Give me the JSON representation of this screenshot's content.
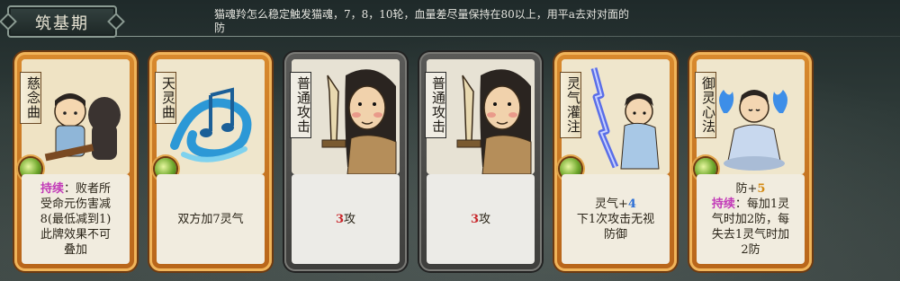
{
  "header": {
    "stage": "筑基期",
    "tip": "猫魂羚怎么稳定触发猫魂，7，8，10轮，血量差尽量保持在80以上，用平a去对对面的防"
  },
  "cards": [
    {
      "name": "慈念曲",
      "style": "gold",
      "desc_lines": [
        [
          {
            "t": "持续",
            "c": "kw-persist"
          },
          {
            "t": "：败者所"
          }
        ],
        [
          {
            "t": "受命元伤害减"
          }
        ],
        [
          {
            "t": "8(最低减到1)"
          }
        ],
        [
          {
            "t": "此牌效果不可"
          }
        ],
        [
          {
            "t": "叠加"
          }
        ]
      ]
    },
    {
      "name": "天灵曲",
      "style": "gold",
      "desc_lines": [
        [
          {
            "t": "双方加7灵气"
          }
        ]
      ]
    },
    {
      "name": "普通攻击",
      "style": "gray",
      "desc_lines": [
        [
          {
            "t": "3",
            "c": "num-red"
          },
          {
            "t": "攻"
          }
        ]
      ]
    },
    {
      "name": "普通攻击",
      "style": "gray",
      "desc_lines": [
        [
          {
            "t": "3",
            "c": "num-red"
          },
          {
            "t": "攻"
          }
        ]
      ]
    },
    {
      "name": "灵气灌注",
      "style": "gold",
      "desc_lines": [
        [
          {
            "t": "灵气+"
          },
          {
            "t": "4",
            "c": "num-blue"
          }
        ],
        [
          {
            "t": "下1次攻击无视"
          }
        ],
        [
          {
            "t": "防御"
          }
        ]
      ]
    },
    {
      "name": "御灵心法",
      "style": "gold",
      "desc_lines": [
        [
          {
            "t": "防+"
          },
          {
            "t": "5",
            "c": "num-gold"
          }
        ],
        [
          {
            "t": "持续",
            "c": "kw-persist"
          },
          {
            "t": "：每加1灵"
          }
        ],
        [
          {
            "t": "气时加2防，每"
          }
        ],
        [
          {
            "t": "失去1灵气时加"
          }
        ],
        [
          {
            "t": "2防"
          }
        ]
      ]
    }
  ]
}
